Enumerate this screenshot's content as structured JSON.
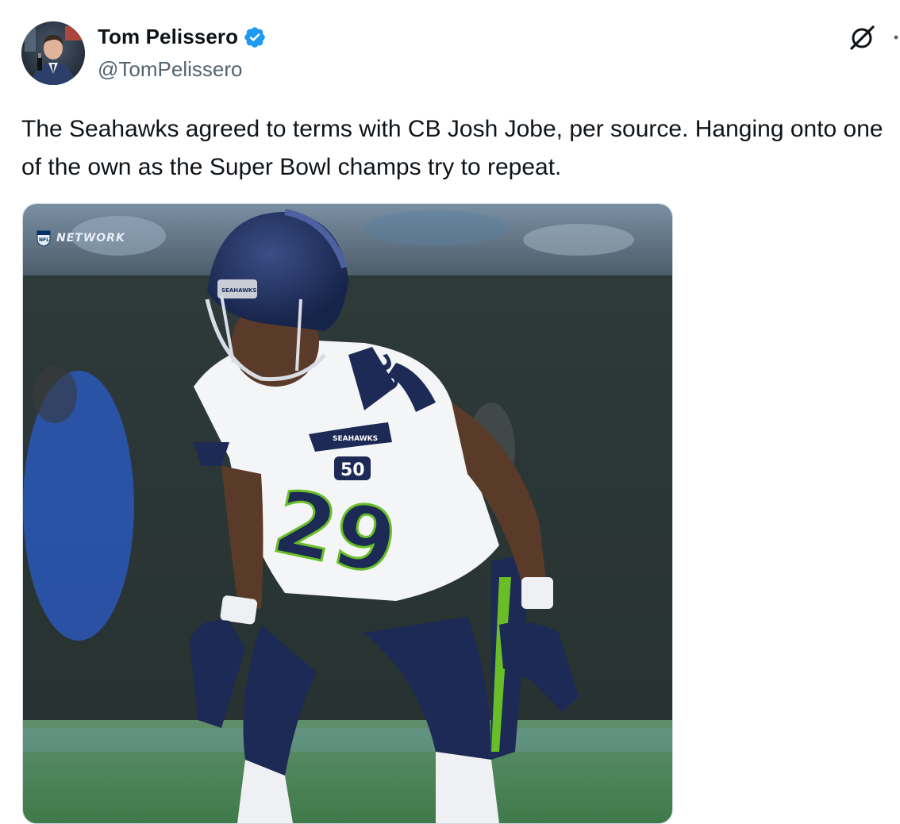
{
  "author": {
    "name": "Tom Pelissero",
    "handle": "@TomPelissero",
    "verified": true,
    "verified_badge_color": "#1d9bf0"
  },
  "tweet": {
    "text": "The Seahawks agreed to terms with CB Josh Jobe, per source. Hanging onto one of the own as the Super Bowl champs try to repeat."
  },
  "media": {
    "watermark": "NETWORK",
    "watermark_badge": "NFL",
    "jersey_number": "29",
    "team_colors": {
      "navy": "#1c2a55",
      "green": "#69be28",
      "white": "#f4f5f7"
    }
  },
  "icons": {
    "grok": "grok-icon",
    "more": "more-icon",
    "verified": "verified-badge-icon"
  }
}
